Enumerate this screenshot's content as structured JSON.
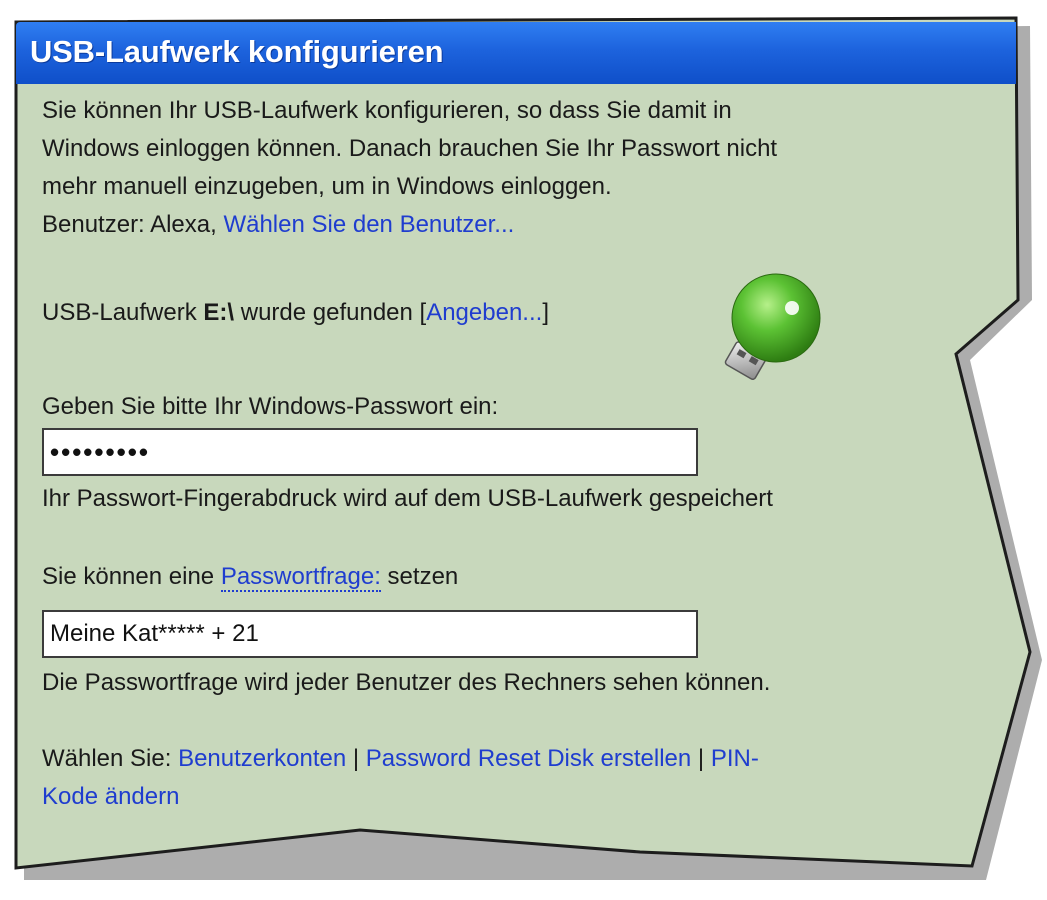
{
  "window": {
    "title": "USB-Laufwerk konfigurieren"
  },
  "intro": {
    "line1": "Sie können Ihr USB-Laufwerk konfigurieren, so dass Sie damit in",
    "line2": "Windows einloggen können. Danach brauchen Sie Ihr Passwort nicht",
    "line3": "mehr manuell einzugeben, um in Windows einloggen."
  },
  "user": {
    "label": "Benutzer:",
    "name": "Alexa,",
    "choose_link": "Wählen Sie den Benutzer..."
  },
  "drive": {
    "text_before": "USB-Laufwerk ",
    "drive_letter": "E:\\",
    "text_after": " wurde gefunden [",
    "specify_link": "Angeben...",
    "close_bracket": "]",
    "icon": "usb-drive-icon",
    "icon_color": "#4caf2a"
  },
  "password": {
    "label": "Geben Sie bitte Ihr Windows-Passwort ein:",
    "value": "•••••••••",
    "hint": "Ihr Passwort-Fingerabdruck wird auf dem USB-Laufwerk gespeichert"
  },
  "question": {
    "label_before": "Sie können eine ",
    "label_link": "Passwortfrage:",
    "label_after": " setzen",
    "value": "Meine Kat***** + 21",
    "hint": "Die Passwortfrage wird jeder Benutzer des Rechners sehen können."
  },
  "footer": {
    "label": "Wählen Sie:",
    "link_accounts": "Benutzerkonten",
    "sep1": "|",
    "link_reset_disk": "Password Reset Disk erstellen",
    "sep2": "|",
    "link_pin_part1": "PIN-",
    "link_pin_part2": "Kode ändern"
  },
  "colors": {
    "panel_bg": "#c8d8bc",
    "title_bg": "#1d63dd",
    "link": "#1f3dcf"
  }
}
